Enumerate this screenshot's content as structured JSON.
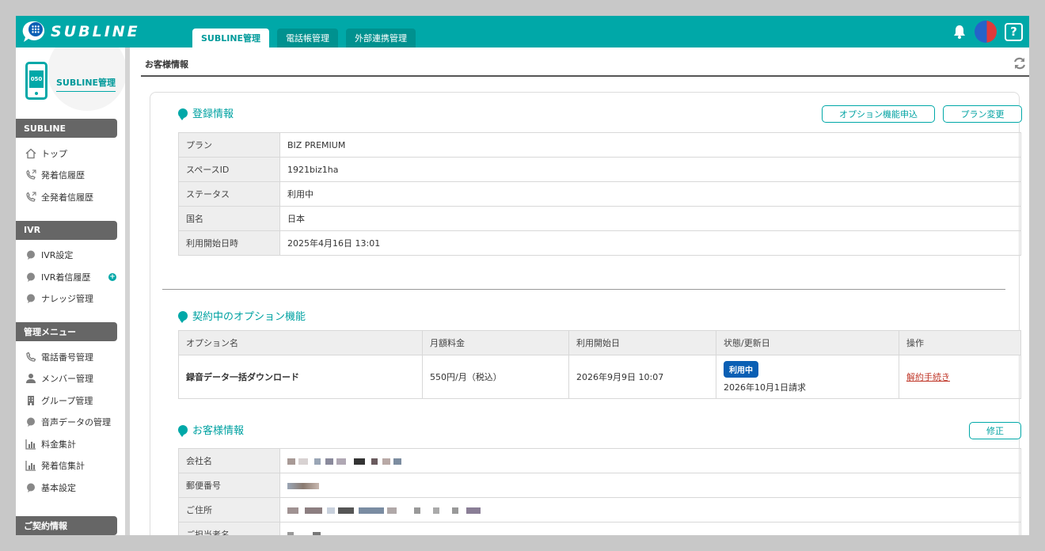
{
  "header": {
    "logo_text": "SUBLINE",
    "tabs": [
      {
        "label": "SUBLINE管理",
        "active": true
      },
      {
        "label": "電話帳管理",
        "active": false
      },
      {
        "label": "外部連携管理",
        "active": false
      }
    ],
    "help_label": "?",
    "accent_color": "#00a8a8"
  },
  "sidebar": {
    "title": "SUBLINE管理",
    "phone_badge": "050",
    "sections": [
      {
        "label": "SUBLINE",
        "items": [
          {
            "label": "トップ",
            "icon": "home-icon"
          },
          {
            "label": "発着信履歴",
            "icon": "phone-call-icon"
          },
          {
            "label": "全発着信履歴",
            "icon": "phone-call-icon"
          }
        ]
      },
      {
        "label": "IVR",
        "items": [
          {
            "label": "IVR設定",
            "icon": "bubble-icon"
          },
          {
            "label": "IVR着信履歴",
            "icon": "bubble-icon"
          },
          {
            "label": "ナレッジ管理",
            "icon": "bubble-icon"
          }
        ]
      },
      {
        "label": "管理メニュー",
        "items": [
          {
            "label": "電話番号管理",
            "icon": "phone-icon"
          },
          {
            "label": "メンバー管理",
            "icon": "user-icon"
          },
          {
            "label": "グループ管理",
            "icon": "building-icon"
          },
          {
            "label": "音声データの管理",
            "icon": "bubble-icon"
          },
          {
            "label": "料金集計",
            "icon": "bar-chart-icon"
          },
          {
            "label": "発着信集計",
            "icon": "bar-chart-icon"
          },
          {
            "label": "基本設定",
            "icon": "bubble-icon"
          }
        ]
      },
      {
        "label": "ご契約情報",
        "items": []
      }
    ]
  },
  "page": {
    "title": "お客様情報"
  },
  "registration": {
    "title": "登録情報",
    "buttons": {
      "option_apply": "オプション機能申込",
      "plan_change": "プラン変更"
    },
    "rows": [
      {
        "label": "プラン",
        "value": "BIZ PREMIUM"
      },
      {
        "label": "スペースID",
        "value": "1921biz1ha"
      },
      {
        "label": "ステータス",
        "value": "利用中"
      },
      {
        "label": "国名",
        "value": "日本"
      },
      {
        "label": "利用開始日時",
        "value": "2025年4月16日 13:01"
      }
    ]
  },
  "options": {
    "title": "契約中のオプション機能",
    "headers": [
      "オプション名",
      "月額料金",
      "利用開始日",
      "状態/更新日",
      "操作"
    ],
    "rows": [
      {
        "name": "録音データ一括ダウンロード",
        "fee": "550円/月（税込）",
        "start": "2026年9月9日 10:07",
        "status_badge": "利用中",
        "renewal": "2026年10月1日請求",
        "action": "解約手続き"
      }
    ]
  },
  "customer": {
    "title": "お客様情報",
    "edit_button": "修正",
    "rows": [
      {
        "label": "会社名"
      },
      {
        "label": "郵便番号"
      },
      {
        "label": "ご住所"
      },
      {
        "label": "ご担当者名"
      }
    ]
  }
}
